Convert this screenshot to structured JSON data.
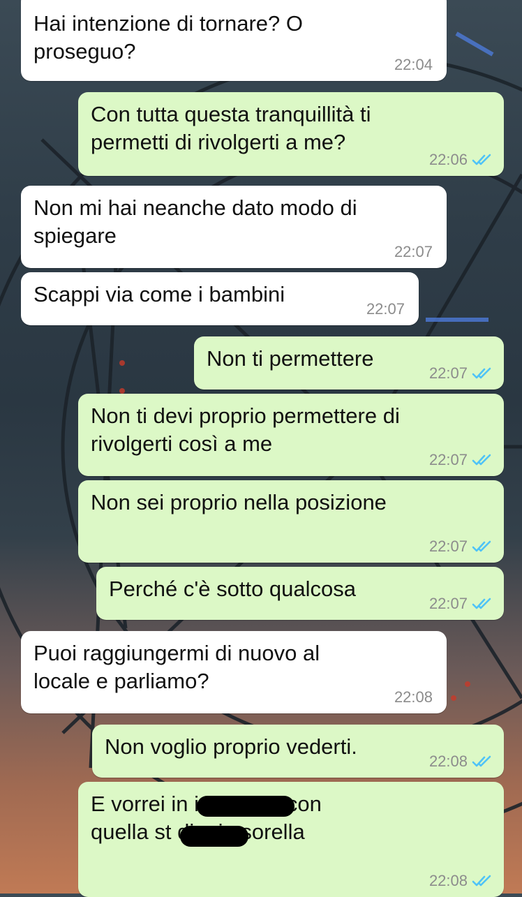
{
  "chat": {
    "messages": [
      {
        "dir": "in",
        "text": "Hai intenzione di tornare? O\nproseguo?",
        "time": "22:04"
      },
      {
        "dir": "out",
        "text": "Con tutta questa tranquillità ti\npermetti di rivolgerti a me?",
        "time": "22:06",
        "status": "read"
      },
      {
        "dir": "in",
        "text": "Non mi hai neanche dato modo di\nspiegare",
        "time": "22:07"
      },
      {
        "dir": "in",
        "text": "Scappi via come i bambini",
        "time": "22:07"
      },
      {
        "dir": "out",
        "text": "Non ti permettere",
        "time": "22:07",
        "status": "read"
      },
      {
        "dir": "out",
        "text": "Non ti devi proprio permettere di\nrivolgerti così a me",
        "time": "22:07",
        "status": "read"
      },
      {
        "dir": "out",
        "text": "Non sei proprio nella posizione",
        "time": "22:07",
        "status": "read"
      },
      {
        "dir": "out",
        "text": "Perché c'è sotto qualcosa",
        "time": "22:07",
        "status": "read"
      },
      {
        "dir": "in",
        "text": "Puoi raggiungermi di nuovo al\nlocale e parliamo?",
        "time": "22:08"
      },
      {
        "dir": "out",
        "text": "Non voglio proprio vederti.",
        "time": "22:08",
        "status": "read"
      },
      {
        "dir": "out",
        "text": "E vorrei in            i a bestia con\nquella st           di mia sorella",
        "time": "22:08",
        "status": "read"
      }
    ]
  },
  "colors": {
    "incoming_bubble": "#ffffff",
    "outgoing_bubble": "#dcf8c6",
    "read_ticks": "#4fc3f7",
    "timestamp": "#8c8c8c"
  },
  "icons": {
    "read_receipt": "double-check-icon"
  }
}
